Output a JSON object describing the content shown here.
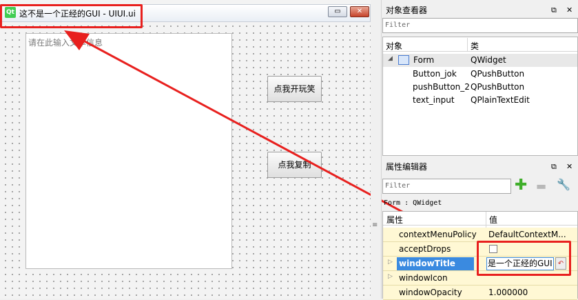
{
  "form_window": {
    "logo_text": "Qt",
    "title": "这不是一个正经的GUI - UIUI.ui",
    "minimize": "▭",
    "close": "✕"
  },
  "form": {
    "text_input_placeholder": "请在此输入文本信息",
    "button_joke": "点我开玩笑",
    "button_copy": "点我复制"
  },
  "object_inspector": {
    "title": "对象查看器",
    "filter_placeholder": "Filter",
    "col_object": "对象",
    "col_class": "类",
    "rows": [
      {
        "object": "Form",
        "class": "QWidget"
      },
      {
        "object": "Button_jok",
        "class": "QPushButton"
      },
      {
        "object": "pushButton_2",
        "class": "QPushButton"
      },
      {
        "object": "text_input",
        "class": "QPlainTextEdit"
      }
    ],
    "float_icon": "⧉",
    "close_icon": "✕"
  },
  "property_editor": {
    "title": "属性编辑器",
    "filter_placeholder": "Filter",
    "plus": "✚",
    "minus": "▬",
    "wrench": "🔧",
    "context": "Form : QWidget",
    "col_property": "属性",
    "col_value": "值",
    "rows": [
      {
        "name": "contextMenuPolicy",
        "value": "DefaultContextM..."
      },
      {
        "name": "acceptDrops",
        "value": ""
      },
      {
        "name": "windowTitle",
        "value": "是一个正经的GUI"
      },
      {
        "name": "windowIcon",
        "value": ""
      },
      {
        "name": "windowOpacity",
        "value": "1.000000"
      }
    ],
    "float_icon": "⧉",
    "close_icon": "✕"
  },
  "colors": {
    "annotation_red": "#e8201e",
    "selection_blue": "#3a8ae0",
    "property_yellow": "#fff8d4"
  }
}
